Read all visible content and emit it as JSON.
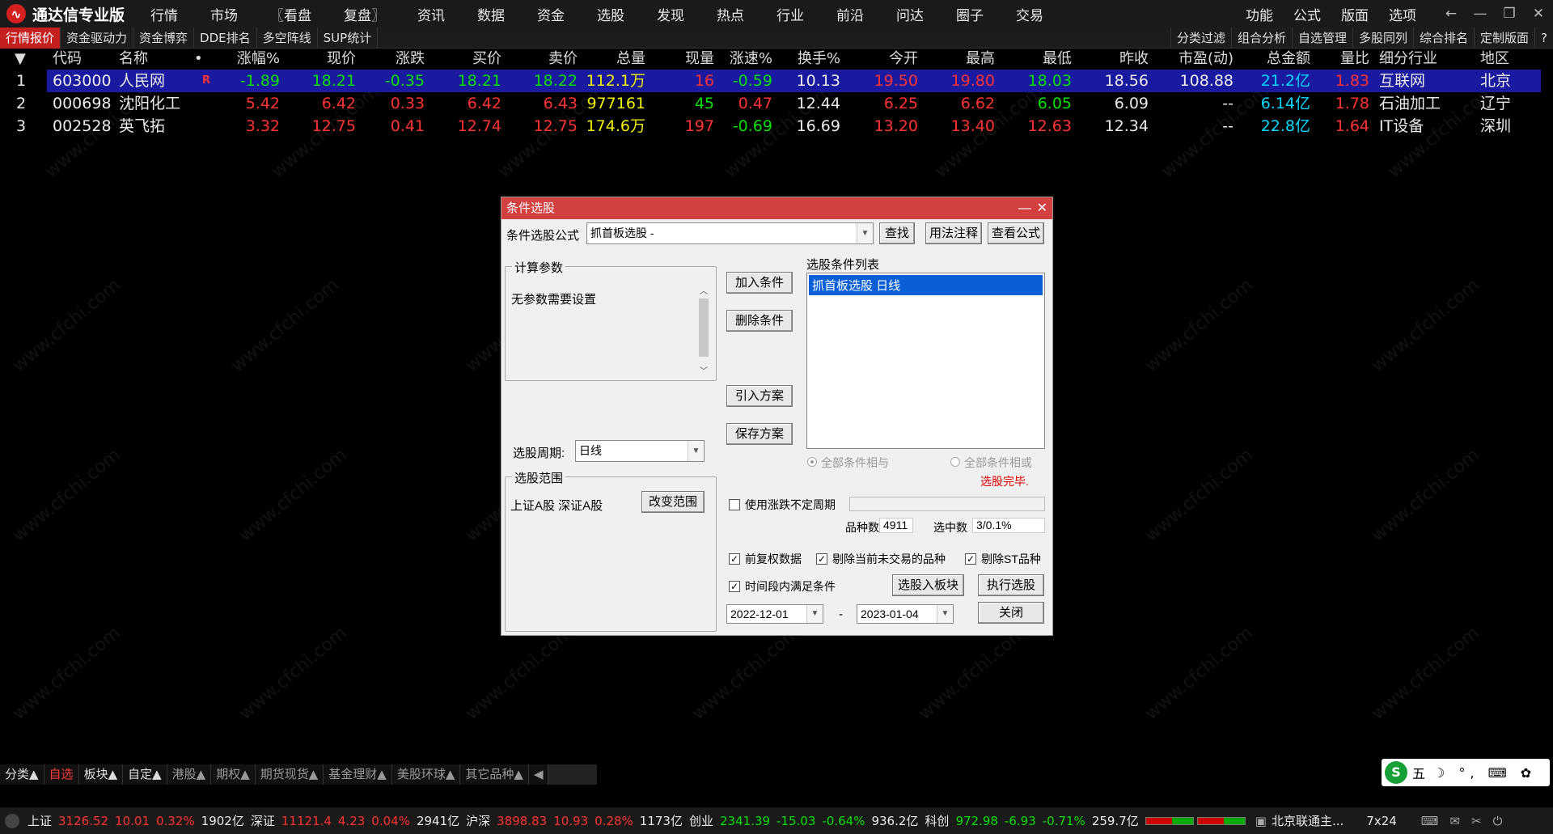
{
  "app": {
    "title": "通达信专业版",
    "logo_glyph": "∿"
  },
  "menu": [
    "行情",
    "市场",
    "〖看盘",
    "复盘〗",
    "资讯",
    "数据",
    "资金",
    "选股",
    "发现",
    "热点",
    "行业",
    "前沿",
    "问达",
    "圈子",
    "交易"
  ],
  "menu_right": [
    "功能",
    "公式",
    "版面",
    "选项"
  ],
  "win_ctrls": [
    "←",
    "—",
    "❐",
    "✕"
  ],
  "tabs": [
    "行情报价",
    "资金驱动力",
    "资金博弈",
    "DDE排名",
    "多空阵线",
    "SUP统计"
  ],
  "tabs_right": [
    "分类过滤",
    "组合分析",
    "自选管理",
    "多股同列",
    "综合排名",
    "定制版面",
    "?"
  ],
  "table": {
    "headers": [
      "▼",
      "代码",
      "名称",
      "•",
      "涨幅%",
      "现价",
      "涨跌",
      "买价",
      "卖价",
      "总量",
      "现量",
      "涨速%",
      "换手%",
      "今开",
      "最高",
      "最低",
      "昨收",
      "市盈(动)",
      "总金额",
      "量比",
      "细分行业",
      "地区"
    ],
    "rows": [
      {
        "n": "1",
        "code": "603000",
        "name": "人民网",
        "tag": "R",
        "chg_pct": "-1.89",
        "price": "18.21",
        "chg": "-0.35",
        "bid": "18.21",
        "ask": "18.22",
        "vol": "112.1万",
        "cur": "16",
        "speed": "-0.59",
        "turn": "10.13",
        "open": "19.50",
        "high": "19.80",
        "low": "18.03",
        "prev": "18.56",
        "pe": "108.88",
        "amount": "21.2亿",
        "ratio": "1.83",
        "industry": "互联网",
        "region": "北京"
      },
      {
        "n": "2",
        "code": "000698",
        "name": "沈阳化工",
        "tag": "",
        "chg_pct": "5.42",
        "price": "6.42",
        "chg": "0.33",
        "bid": "6.42",
        "ask": "6.43",
        "vol": "977161",
        "cur": "45",
        "speed": "0.47",
        "turn": "12.44",
        "open": "6.25",
        "high": "6.62",
        "low": "6.05",
        "prev": "6.09",
        "pe": "--",
        "amount": "6.14亿",
        "ratio": "1.78",
        "industry": "石油加工",
        "region": "辽宁"
      },
      {
        "n": "3",
        "code": "002528",
        "name": "英飞拓",
        "tag": "",
        "chg_pct": "3.32",
        "price": "12.75",
        "chg": "0.41",
        "bid": "12.74",
        "ask": "12.75",
        "vol": "174.6万",
        "cur": "197",
        "speed": "-0.69",
        "turn": "16.69",
        "open": "13.20",
        "high": "13.40",
        "low": "12.63",
        "prev": "12.34",
        "pe": "--",
        "amount": "22.8亿",
        "ratio": "1.64",
        "industry": "IT设备",
        "region": "深圳"
      }
    ]
  },
  "watermark": "www.cfchi.com",
  "dialog": {
    "title": "条件选股",
    "formula_label": "条件选股公式",
    "formula_value": "抓首板选股   -",
    "find": "查找",
    "usage": "用法注释",
    "view_formula": "查看公式",
    "params_label": "计算参数",
    "params_text": "无参数需要设置",
    "period_label": "选股周期:",
    "period_value": "日线",
    "range_label": "选股范围",
    "range_value": "上证A股 深证A股",
    "change_range": "改变范围",
    "add_cond": "加入条件",
    "del_cond": "删除条件",
    "import_plan": "引入方案",
    "save_plan": "保存方案",
    "cond_list_label": "选股条件列表",
    "cond_item": "抓首板选股  日线",
    "and_label": "全部条件相与",
    "or_label": "全部条件相或",
    "done": "选股完毕.",
    "use_uncertain": "使用涨跌不定周期",
    "count_label": "品种数",
    "count_value": "4911",
    "selected_label": "选中数",
    "selected_value": "3/0.1%",
    "pre_adjust": "前复权数据",
    "remove_untraded": "剔除当前未交易的品种",
    "remove_st": "剔除ST品种",
    "time_cond": "时间段内满足条件",
    "to_block": "选股入板块",
    "execute": "执行选股",
    "date_from": "2022-12-01",
    "date_sep": "-",
    "date_to": "2023-01-04",
    "close": "关闭",
    "min_ctrl": "—",
    "close_ctrl": "✕"
  },
  "bottom_tabs": [
    "分类▲",
    "自选",
    "板块▲",
    "自定▲",
    "港股▲",
    "期权▲",
    "期货现货▲",
    "基金理财▲",
    "美股环球▲",
    "其它品种▲",
    "◀"
  ],
  "ime": {
    "s": "S",
    "label": "五",
    "icons": "☽ °, ⌨ ✿"
  },
  "status": {
    "sh_label": "上证",
    "sh_val": "3126.52",
    "sh_chg": "10.01",
    "sh_pct": "0.32%",
    "sh_amt": "1902亿",
    "sz_label": "深证",
    "sz_val": "11121.4",
    "sz_chg": "4.23",
    "sz_pct": "0.04%",
    "sz_amt": "2941亿",
    "hs_label": "沪深",
    "hs_val": "3898.83",
    "hs_chg": "10.93",
    "hs_pct": "0.28%",
    "hs_amt": "1173亿",
    "cy_label": "创业",
    "cy_val": "2341.39",
    "cy_chg": "-15.03",
    "cy_pct": "-0.64%",
    "cy_amt": "936.2亿",
    "kc_label": "科创",
    "kc_val": "972.98",
    "kc_chg": "-6.93",
    "kc_pct": "-0.71%",
    "kc_amt": "259.7亿",
    "server": "北京联通主...",
    "hours": "7x24"
  }
}
